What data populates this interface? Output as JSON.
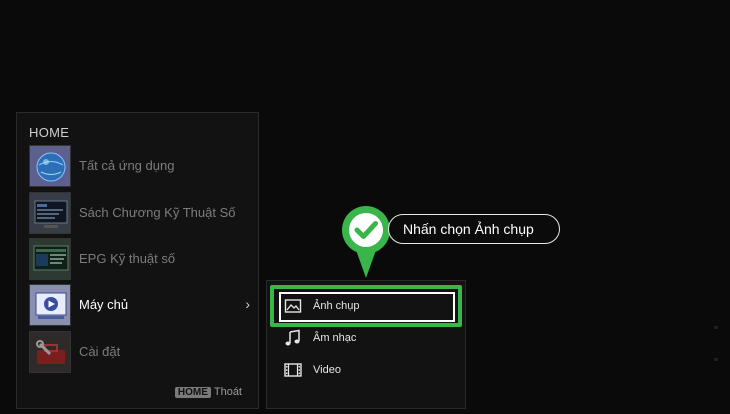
{
  "home": {
    "title": "HOME",
    "items": [
      {
        "label": "Tất cả ứng dụng",
        "icon": "globe-icon"
      },
      {
        "label": "Sách Chương Kỹ Thuật Số",
        "icon": "tv-guide-icon"
      },
      {
        "label": "EPG Kỹ thuật số",
        "icon": "epg-icon"
      },
      {
        "label": "Máy chủ",
        "icon": "media-server-icon",
        "active": true
      },
      {
        "label": "Cài đặt",
        "icon": "settings-toolbox-icon"
      }
    ],
    "chevron": "›",
    "footer": {
      "key": "HOME",
      "label": "Thoát"
    }
  },
  "submenu": {
    "items": [
      {
        "label": "Ảnh chụp",
        "icon": "photo-icon",
        "selected": true
      },
      {
        "label": "Âm nhạc",
        "icon": "music-note-icon"
      },
      {
        "label": "Video",
        "icon": "film-strip-icon"
      }
    ]
  },
  "annotation": {
    "text": "Nhấn chọn Ảnh chụp",
    "accent_color": "#39b54a"
  }
}
